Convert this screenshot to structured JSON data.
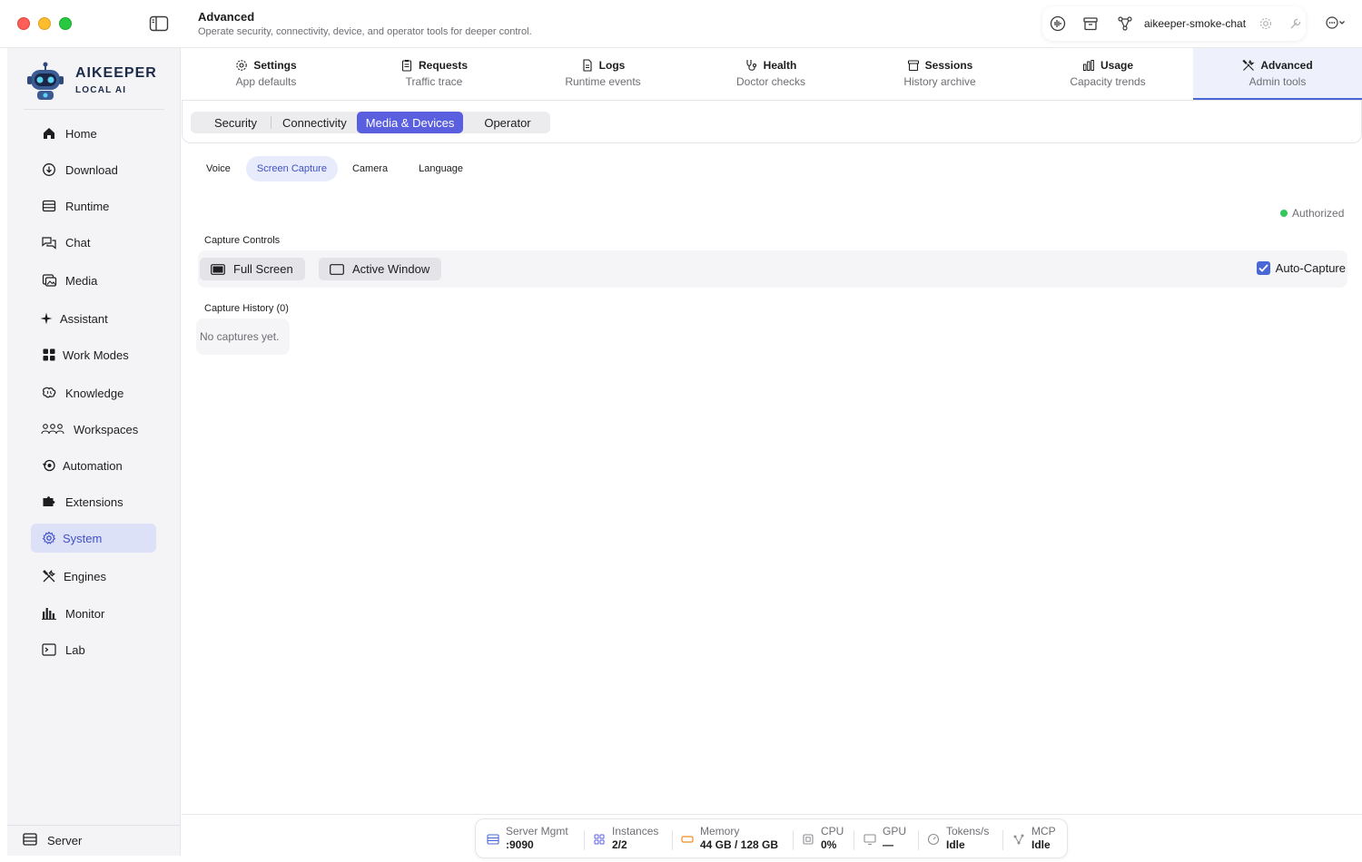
{
  "window": {
    "title": "Advanced",
    "subtitle": "Operate security, connectivity, device, and operator tools for deeper control.",
    "chat_name": "aikeeper-smoke-chat"
  },
  "brand": {
    "name": "AIKEEPER",
    "tagline": "LOCAL AI"
  },
  "sidebar": {
    "items": [
      {
        "label": "Home",
        "icon": "home-icon"
      },
      {
        "label": "Download",
        "icon": "download-icon"
      },
      {
        "label": "Runtime",
        "icon": "runtime-icon"
      },
      {
        "label": "Chat",
        "icon": "chat-icon"
      },
      {
        "label": "Media",
        "icon": "media-icon"
      },
      {
        "label": "Assistant",
        "icon": "sparkle-icon"
      },
      {
        "label": "Work Modes",
        "icon": "grid-icon"
      },
      {
        "label": "Knowledge",
        "icon": "brain-icon"
      },
      {
        "label": "Workspaces",
        "icon": "people-icon"
      },
      {
        "label": "Automation",
        "icon": "automation-icon"
      },
      {
        "label": "Extensions",
        "icon": "puzzle-icon"
      },
      {
        "label": "System",
        "icon": "gear-icon",
        "active": true
      },
      {
        "label": "Engines",
        "icon": "tools-icon"
      },
      {
        "label": "Monitor",
        "icon": "bar-chart-icon"
      },
      {
        "label": "Lab",
        "icon": "terminal-icon"
      }
    ],
    "footer": {
      "label": "Server",
      "icon": "server-icon"
    }
  },
  "top_tabs": [
    {
      "title": "Settings",
      "subtitle": "App defaults",
      "icon": "gear-icon"
    },
    {
      "title": "Requests",
      "subtitle": "Traffic trace",
      "icon": "clipboard-icon"
    },
    {
      "title": "Logs",
      "subtitle": "Runtime events",
      "icon": "document-icon"
    },
    {
      "title": "Health",
      "subtitle": "Doctor checks",
      "icon": "stethoscope-icon"
    },
    {
      "title": "Sessions",
      "subtitle": "History archive",
      "icon": "archive-icon"
    },
    {
      "title": "Usage",
      "subtitle": "Capacity trends",
      "icon": "bar-chart-icon"
    },
    {
      "title": "Advanced",
      "subtitle": "Admin tools",
      "icon": "tools-icon",
      "active": true
    }
  ],
  "segments": [
    {
      "label": "Security"
    },
    {
      "label": "Connectivity"
    },
    {
      "label": "Media & Devices",
      "active": true
    },
    {
      "label": "Operator"
    }
  ],
  "sub_tabs": [
    {
      "label": "Voice"
    },
    {
      "label": "Screen Capture",
      "active": true
    },
    {
      "label": "Camera"
    },
    {
      "label": "Language"
    }
  ],
  "capture": {
    "status": "Authorized",
    "controls_title": "Capture Controls",
    "full_screen_label": "Full Screen",
    "active_window_label": "Active Window",
    "auto_capture_label": "Auto-Capture",
    "auto_capture_checked": true,
    "history_title": "Capture History (0)",
    "empty_text": "No captures yet."
  },
  "status_bar": [
    {
      "key": "Server Mgmt",
      "value": ":9090",
      "icon": "server-icon"
    },
    {
      "key": "Instances",
      "value": "2/2",
      "icon": "grid-icon"
    },
    {
      "key": "Memory",
      "value": "44 GB / 128 GB",
      "icon": "memory-icon"
    },
    {
      "key": "CPU",
      "value": "0%",
      "icon": "cpu-icon"
    },
    {
      "key": "GPU",
      "value": "—",
      "icon": "monitor-icon"
    },
    {
      "key": "Tokens/s",
      "value": "Idle",
      "icon": "gauge-icon"
    },
    {
      "key": "MCP",
      "value": "Idle",
      "icon": "nodes-icon"
    }
  ],
  "colors": {
    "accent": "#5a5fe0",
    "active_nav_bg": "#dde1f7",
    "status_ok": "#34c759"
  }
}
